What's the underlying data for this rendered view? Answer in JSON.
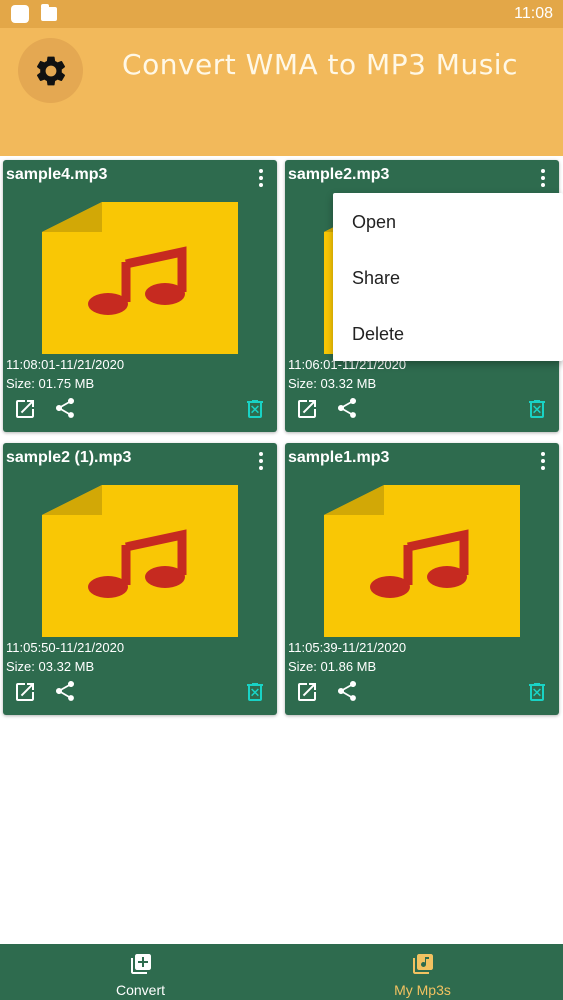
{
  "status_bar": {
    "time": "11:08"
  },
  "header": {
    "title": "Convert WMA to MP3 Music",
    "settings_icon": "gear-icon"
  },
  "files": [
    {
      "name": "sample4.mp3",
      "date": "11:08:01-11/21/2020",
      "size": "Size: 01.75 MB"
    },
    {
      "name": "sample2.mp3",
      "date": "11:06:01-11/21/2020",
      "size": "Size: 03.32 MB"
    },
    {
      "name": "sample2 (1).mp3",
      "date": "11:05:50-11/21/2020",
      "size": "Size: 03.32 MB"
    },
    {
      "name": "sample1.mp3",
      "date": "11:05:39-11/21/2020",
      "size": "Size: 01.86 MB"
    }
  ],
  "popup_menu": {
    "items": [
      "Open",
      "Share",
      "Delete"
    ]
  },
  "bottom_nav": {
    "items": [
      {
        "label": "Convert",
        "icon": "add-library-icon",
        "active": false
      },
      {
        "label": "My Mp3s",
        "icon": "music-library-icon",
        "active": true
      }
    ]
  },
  "colors": {
    "status_bar": "#e3a748",
    "header": "#f2b95b",
    "card": "#2e6b4e",
    "folder": "#f9c705",
    "note": "#c62a20",
    "delete_icon": "#19d3c5",
    "nav_active": "#f2c261"
  }
}
